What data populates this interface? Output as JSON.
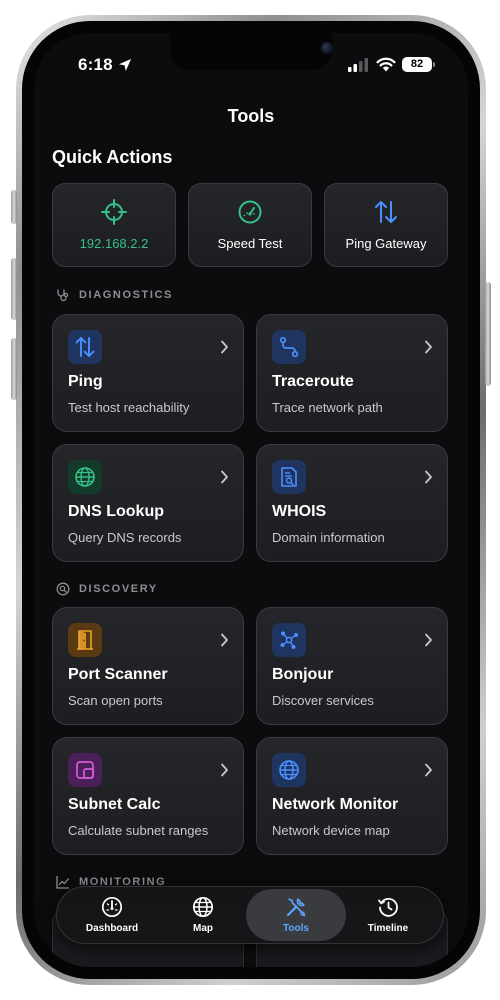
{
  "status_bar": {
    "time": "6:18",
    "battery": "82"
  },
  "header": {
    "title": "Tools"
  },
  "quick_actions": {
    "title": "Quick Actions",
    "items": [
      {
        "label": "192.168.2.2",
        "icon": "crosshair-icon",
        "color": "#34c08a"
      },
      {
        "label": "Speed Test",
        "icon": "speedometer-icon",
        "color": "#34c08a"
      },
      {
        "label": "Ping Gateway",
        "icon": "arrows-up-down-icon",
        "color": "#4a90ff"
      }
    ]
  },
  "sections": {
    "diagnostics": {
      "title": "DIAGNOSTICS",
      "items": [
        {
          "name": "Ping",
          "desc": "Test host reachability",
          "icon": "arrows-up-down-icon"
        },
        {
          "name": "Traceroute",
          "desc": "Trace network path",
          "icon": "route-icon"
        },
        {
          "name": "DNS Lookup",
          "desc": "Query DNS records",
          "icon": "globe-icon"
        },
        {
          "name": "WHOIS",
          "desc": "Domain information",
          "icon": "document-search-icon"
        }
      ]
    },
    "discovery": {
      "title": "DISCOVERY",
      "items": [
        {
          "name": "Port Scanner",
          "desc": "Scan open ports",
          "icon": "door-icon"
        },
        {
          "name": "Bonjour",
          "desc": "Discover services",
          "icon": "network-nodes-icon"
        },
        {
          "name": "Subnet Calc",
          "desc": "Calculate subnet ranges",
          "icon": "square-corner-icon"
        },
        {
          "name": "Network Monitor",
          "desc": "Network device map",
          "icon": "globe-icon"
        }
      ]
    },
    "monitoring": {
      "title": "MONITORING"
    }
  },
  "tab_bar": {
    "tabs": [
      {
        "label": "Dashboard",
        "icon": "gauge-icon"
      },
      {
        "label": "Map",
        "icon": "globe-icon"
      },
      {
        "label": "Tools",
        "icon": "tools-icon",
        "active": true
      },
      {
        "label": "Timeline",
        "icon": "history-icon"
      }
    ]
  },
  "colors": {
    "accent_blue": "#4a90ff",
    "accent_green": "#34c08a",
    "background": "#0c0c0e",
    "card": "#222327"
  }
}
